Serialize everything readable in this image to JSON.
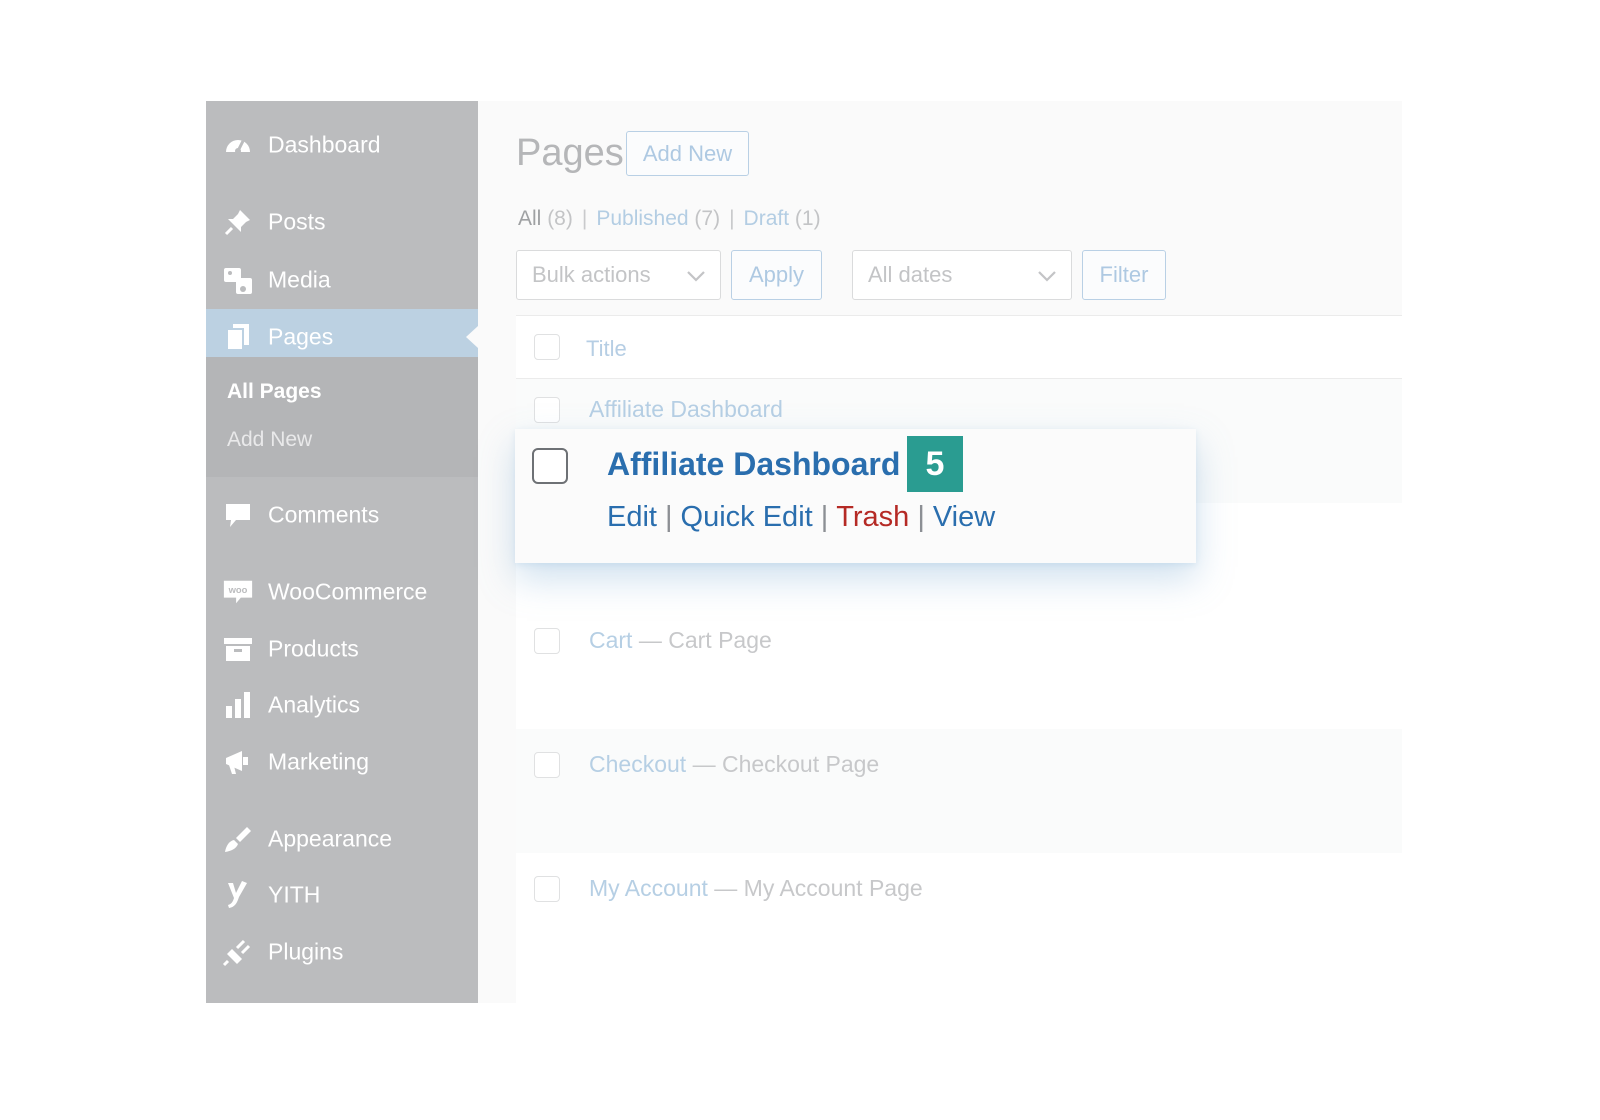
{
  "sidebar": {
    "items": [
      {
        "label": "Dashboard",
        "icon": "dashboard-gauge-icon"
      },
      {
        "label": "Posts",
        "icon": "pushpin-icon"
      },
      {
        "label": "Media",
        "icon": "media-icon"
      },
      {
        "label": "Pages",
        "icon": "pages-icon",
        "active": true
      },
      {
        "label": "Comments",
        "icon": "comment-bubble-icon"
      },
      {
        "label": "WooCommerce",
        "icon": "woo-icon"
      },
      {
        "label": "Products",
        "icon": "archive-box-icon"
      },
      {
        "label": "Analytics",
        "icon": "bar-chart-icon"
      },
      {
        "label": "Marketing",
        "icon": "megaphone-icon"
      },
      {
        "label": "Appearance",
        "icon": "paintbrush-icon"
      },
      {
        "label": "YITH",
        "icon": "yith-icon"
      },
      {
        "label": "Plugins",
        "icon": "plug-icon"
      }
    ],
    "woo_icon_text": "woo",
    "submenu": {
      "all_pages": "All Pages",
      "add_new": "Add New"
    }
  },
  "header": {
    "title": "Pages",
    "add_new": "Add New"
  },
  "filters": {
    "all": {
      "label": "All",
      "count": "(8)"
    },
    "published": {
      "label": "Published",
      "count": "(7)"
    },
    "draft": {
      "label": "Draft",
      "count": "(1)"
    },
    "separator": "|"
  },
  "bulk": {
    "select": "Bulk actions",
    "apply": "Apply",
    "dates": "All dates",
    "filter": "Filter"
  },
  "table": {
    "column_title": "Title",
    "rows": [
      {
        "title": "Affiliate Dashboard"
      },
      {
        "title": "Cart",
        "suffix": "— Cart Page"
      },
      {
        "title": "Checkout",
        "suffix": "— Checkout Page"
      },
      {
        "title": "My Account",
        "suffix": "— My Account Page"
      }
    ]
  },
  "highlight": {
    "title": "Affiliate Dashboard",
    "step_badge": "5",
    "actions": {
      "edit": "Edit",
      "quick_edit": "Quick Edit",
      "trash": "Trash",
      "view": "View"
    }
  },
  "colors": {
    "link": "#2a6eae",
    "trash": "#b52a25",
    "badge": "#2a9c91",
    "sidebar": "#bbbcbe",
    "sidebar_active": "#bcd1e2"
  }
}
